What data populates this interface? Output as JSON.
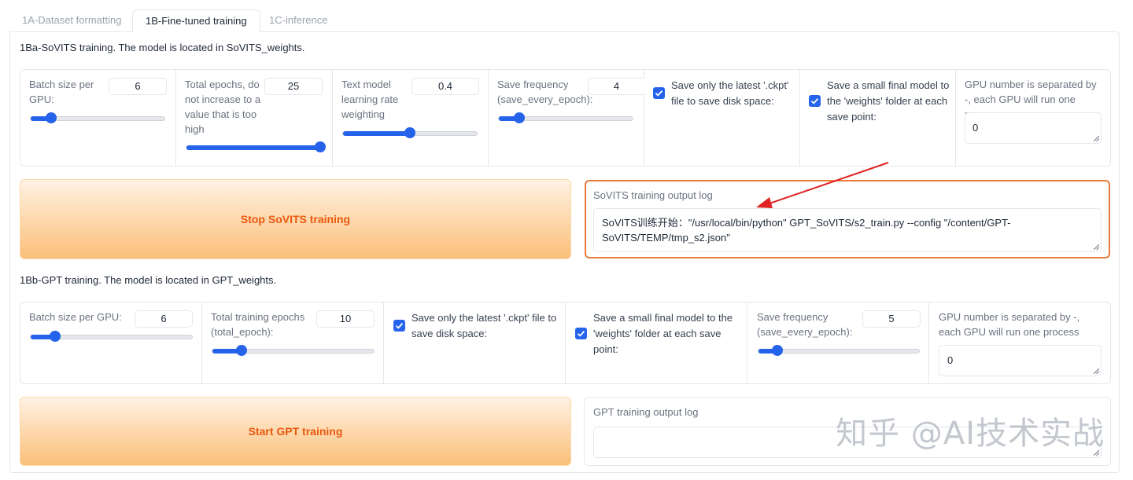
{
  "tabs": [
    {
      "label": "1A-Dataset formatting",
      "active": false
    },
    {
      "label": "1B-Fine-tuned training",
      "active": true
    },
    {
      "label": "1C-inference",
      "active": false
    }
  ],
  "sovits": {
    "heading": "1Ba-SoVITS training. The model is located in SoVITS_weights.",
    "batch_size": {
      "label": "Batch size per GPU:",
      "value": "6",
      "slider_fraction": 0.15
    },
    "total_epochs": {
      "label": "Total epochs, do not increase to a value that is too high",
      "value": "25",
      "slider_fraction": 1.0
    },
    "text_lr": {
      "label": "Text model learning rate weighting",
      "value": "0.4",
      "slider_fraction": 0.5
    },
    "save_freq": {
      "label": "Save frequency (save_every_epoch):",
      "value": "4",
      "slider_fraction": 0.15
    },
    "save_latest": {
      "label": "Save only the latest '.ckpt' file to save disk space:",
      "checked": true
    },
    "save_small": {
      "label": "Save a small final model to the 'weights' folder at each save point:",
      "checked": true
    },
    "gpu": {
      "label": "GPU number is separated by -, each GPU will run one process",
      "value": "0"
    },
    "button_label": "Stop SoVITS training",
    "log": {
      "label": "SoVITS training output log",
      "text": "SoVITS训练开始：\"/usr/local/bin/python\" GPT_SoVITS/s2_train.py --config \"/content/GPT-SoVITS/TEMP/tmp_s2.json\""
    }
  },
  "gpt": {
    "heading": "1Bb-GPT training. The model is located in GPT_weights.",
    "batch_size": {
      "label": "Batch size per GPU:",
      "value": "6",
      "slider_fraction": 0.15
    },
    "total_epochs": {
      "label": "Total training epochs (total_epoch):",
      "value": "10",
      "slider_fraction": 0.18
    },
    "save_latest": {
      "label": "Save only the latest '.ckpt' file to save disk space:",
      "checked": true
    },
    "save_small": {
      "label": "Save a small final model to the 'weights' folder at each save point:",
      "checked": true
    },
    "save_freq": {
      "label": "Save frequency (save_every_epoch):",
      "value": "5",
      "slider_fraction": 0.12
    },
    "gpu": {
      "label": "GPU number is separated by -, each GPU will run one process",
      "value": "0"
    },
    "button_label": "Start GPT training",
    "log": {
      "label": "GPT training output log",
      "text": ""
    }
  },
  "colors": {
    "accent": "#2563eb",
    "button_text": "#ea580c",
    "highlight_border": "#ea7a3a",
    "arrow": "#e02424"
  },
  "watermark": "知乎 @AI技术实战"
}
